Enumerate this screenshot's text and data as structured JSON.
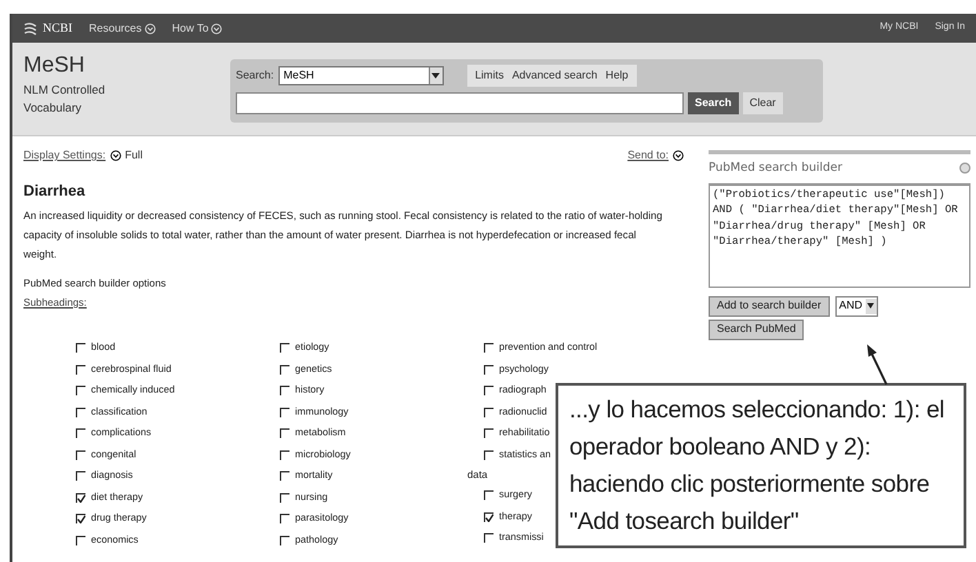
{
  "top_bar": {
    "logo": "NCBI",
    "menus": [
      {
        "label": "Resources"
      },
      {
        "label": "How To"
      }
    ],
    "links": [
      "My NCBI",
      "Sign In"
    ]
  },
  "header": {
    "title": "MeSH",
    "subtitle": "NLM Controlled Vocabulary",
    "search_label": "Search:",
    "database": "MeSH",
    "links": [
      "Limits",
      "Advanced search",
      "Help"
    ],
    "search_button": "Search",
    "clear_button": "Clear"
  },
  "display_settings": {
    "label": "Display Settings:",
    "value": "Full"
  },
  "send_to": "Send to:",
  "term": {
    "title": "Diarrhea",
    "definition": "An increased liquidity or decreased consistency of FECES, such as running stool. Fecal consistency is related to the ratio of water-holding capacity of insoluble solids to total water, rather than the amount of water present. Diarrhea is not hyperdefecation or increased fecal weight."
  },
  "options_heading": "PubMed search builder options",
  "subheadings_label": "Subheadings:",
  "subheadings": [
    [
      {
        "label": "blood",
        "checked": false
      },
      {
        "label": "cerebrospinal fluid",
        "checked": false
      },
      {
        "label": "chemically induced",
        "checked": false
      },
      {
        "label": "classification",
        "checked": false
      },
      {
        "label": "complications",
        "checked": false
      },
      {
        "label": "congenital",
        "checked": false
      },
      {
        "label": "diagnosis",
        "checked": false
      },
      {
        "label": "diet therapy",
        "checked": true
      },
      {
        "label": "drug therapy",
        "checked": true
      },
      {
        "label": "economics",
        "checked": false
      }
    ],
    [
      {
        "label": "etiology",
        "checked": false
      },
      {
        "label": "genetics",
        "checked": false
      },
      {
        "label": "history",
        "checked": false
      },
      {
        "label": "immunology",
        "checked": false
      },
      {
        "label": "metabolism",
        "checked": false
      },
      {
        "label": "microbiology",
        "checked": false
      },
      {
        "label": "mortality",
        "checked": false
      },
      {
        "label": "nursing",
        "checked": false
      },
      {
        "label": "parasitology",
        "checked": false
      },
      {
        "label": "pathology",
        "checked": false
      }
    ],
    [
      {
        "label": "prevention and control",
        "checked": false
      },
      {
        "label": "psychology",
        "checked": false
      },
      {
        "label": "radiograph",
        "checked": false
      },
      {
        "label": "radionuclid",
        "checked": false
      },
      {
        "label": "rehabilitatio",
        "checked": false
      },
      {
        "label": "statistics an",
        "checked": false,
        "continuation": "data"
      },
      {
        "label": "surgery",
        "checked": false
      },
      {
        "label": "therapy",
        "checked": true
      },
      {
        "label": "transmissi",
        "checked": false
      }
    ]
  ],
  "search_builder": {
    "title": "PubMed search builder",
    "query": "(\"Probiotics/therapeutic use\"[Mesh]) AND ( \"Diarrhea/diet therapy\"[Mesh] OR  \"Diarrhea/drug therapy\" [Mesh] OR  \"Diarrhea/therapy\" [Mesh] )",
    "add_button": "Add to search builder",
    "operator": "AND",
    "search_button": "Search PubMed"
  },
  "callout": {
    "text": "...y lo hacemos seleccionando: 1): el operador booleano AND y 2): haciendo  clic posteriormente sobre \"Add tosearch builder\""
  }
}
